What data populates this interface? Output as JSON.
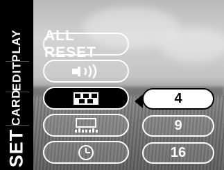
{
  "tabs": {
    "play": "PLAY",
    "edit": "EDIT",
    "card": "CARD",
    "set": "SET"
  },
  "menu": {
    "all_reset_label": "ALL RESET",
    "items": [
      {
        "icon": "beep-sound-icon"
      },
      {
        "icon": "index-layout-icon"
      },
      {
        "icon": "screen-brightness-icon"
      },
      {
        "icon": "clock-icon"
      }
    ],
    "selected_index": 2
  },
  "options": [
    {
      "label": "4",
      "selected": true
    },
    {
      "label": "9",
      "selected": false
    },
    {
      "label": "16",
      "selected": false
    }
  ]
}
